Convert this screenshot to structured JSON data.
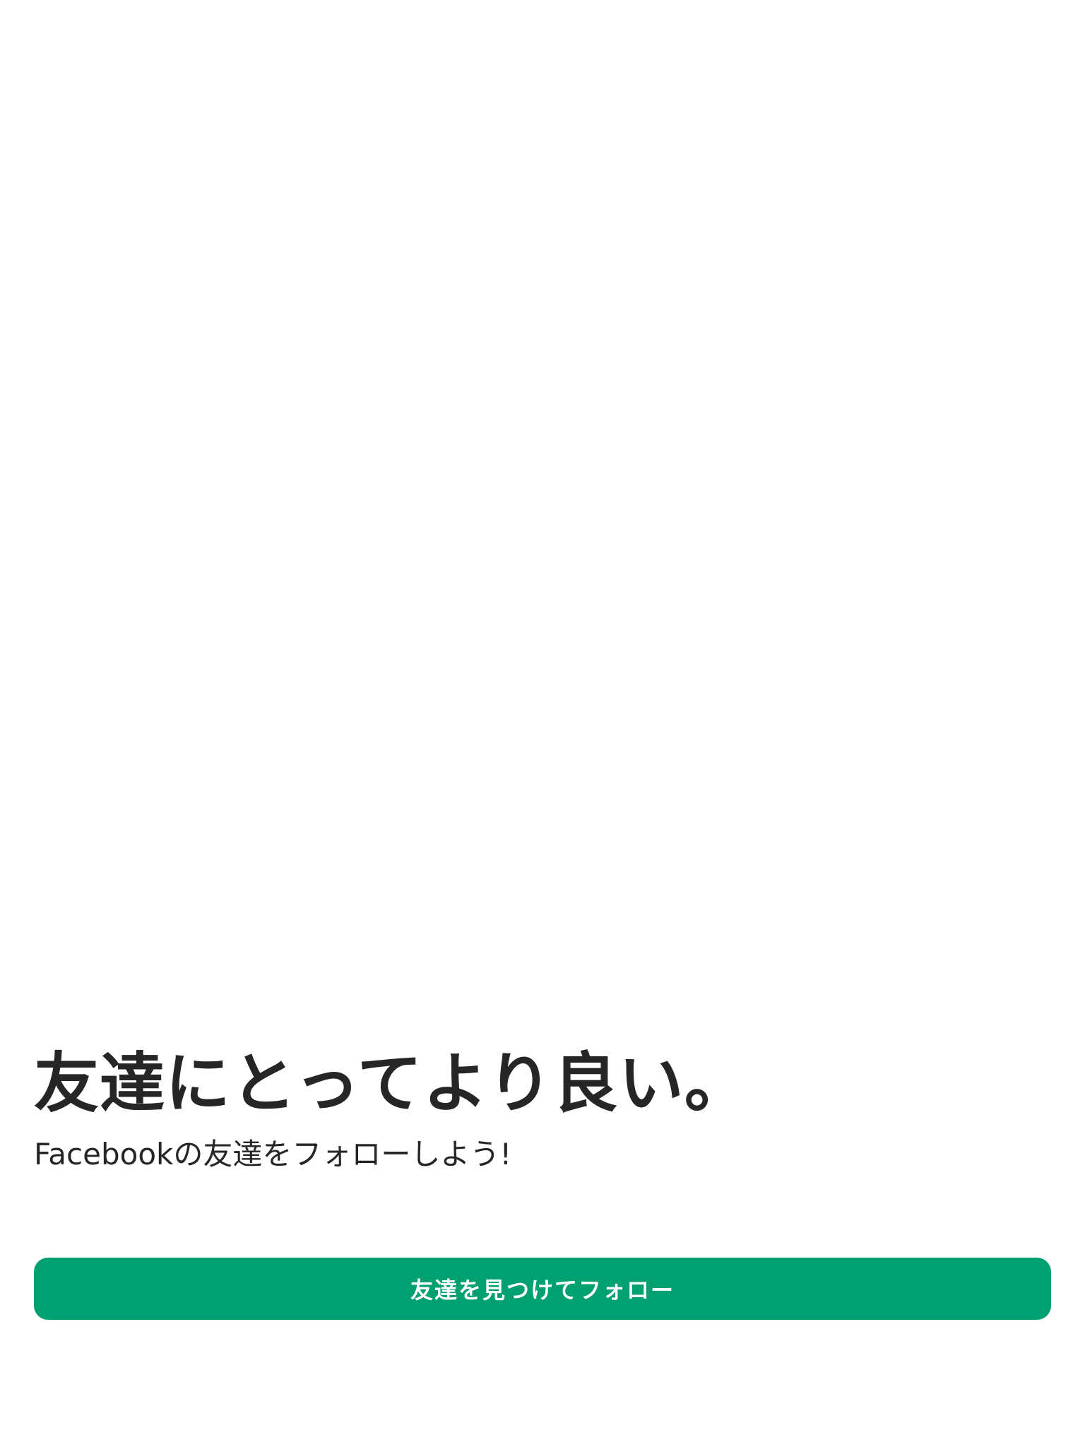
{
  "onboarding": {
    "headline": "友達にとってより良い。",
    "subtitle": "Facebookの友達をフォローしよう!",
    "cta_label": "友達を見つけてフォロー"
  },
  "colors": {
    "accent": "#00a070",
    "text": "#262626",
    "background": "#ffffff"
  }
}
